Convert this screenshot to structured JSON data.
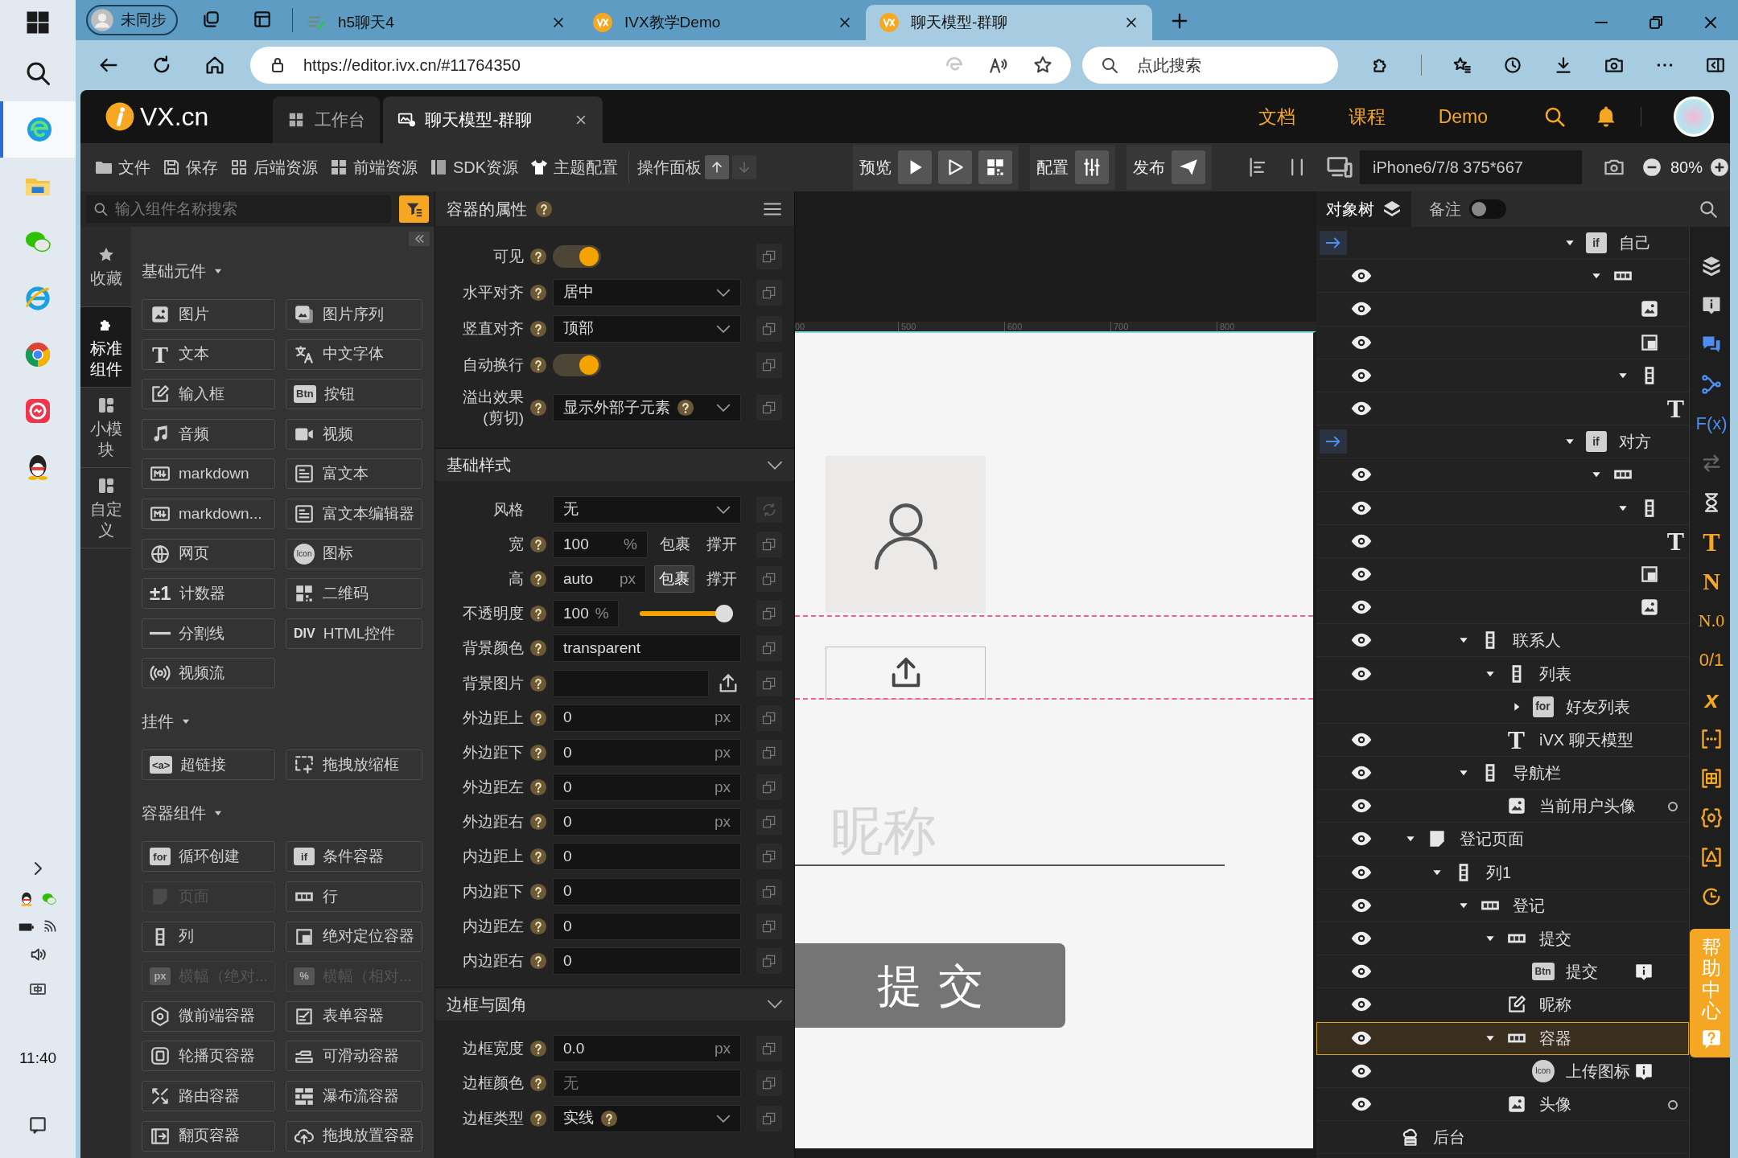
{
  "os_taskbar": {
    "time": "11:40"
  },
  "browser": {
    "profile": "未同步",
    "tabs": [
      {
        "title": "h5聊天4",
        "selected": false
      },
      {
        "title": "IVX教学Demo",
        "selected": false
      },
      {
        "title": "聊天模型-群聊",
        "selected": true
      }
    ],
    "url": "https://editor.ivx.cn/#11764350",
    "search_placeholder": "点此搜索"
  },
  "header": {
    "logo": "VX.cn",
    "tabs": [
      {
        "label": "工作台",
        "selected": false
      },
      {
        "label": "聊天模型-群聊",
        "selected": true
      }
    ],
    "links": [
      "文档",
      "课程",
      "Demo"
    ]
  },
  "toolbar": {
    "items": [
      "文件",
      "保存",
      "后端资源",
      "前端资源",
      "SDK资源",
      "主题配置"
    ],
    "panel_label": "操作面板",
    "preview": "预览",
    "config": "配置",
    "publish": "发布",
    "device": "iPhone6/7/8 375*667",
    "zoom": "80%"
  },
  "components": {
    "search_placeholder": "输入组件名称搜索",
    "side_tabs": [
      {
        "label": "收藏",
        "selected": false
      },
      {
        "label": "标准组件",
        "selected": true
      },
      {
        "label": "小模块",
        "selected": false
      },
      {
        "label": "自定义",
        "selected": false
      }
    ],
    "sections": [
      {
        "title": "基础元件",
        "items": [
          {
            "label": "图片",
            "disabled": false
          },
          {
            "label": "图片序列",
            "disabled": false
          },
          {
            "label": "文本",
            "badge": "T",
            "disabled": false
          },
          {
            "label": "中文字体",
            "disabled": false
          },
          {
            "label": "输入框",
            "disabled": false
          },
          {
            "label": "按钮",
            "badge": "Btn",
            "disabled": false
          },
          {
            "label": "音频",
            "disabled": false
          },
          {
            "label": "视频",
            "disabled": false
          },
          {
            "label": "markdown",
            "disabled": false
          },
          {
            "label": "富文本",
            "disabled": false
          },
          {
            "label": "markdown...",
            "disabled": false
          },
          {
            "label": "富文本编辑器",
            "disabled": false
          },
          {
            "label": "网页",
            "disabled": false
          },
          {
            "label": "图标",
            "badge": "Icon",
            "disabled": false
          },
          {
            "label": "计数器",
            "badge": "±1",
            "disabled": false
          },
          {
            "label": "二维码",
            "disabled": false
          },
          {
            "label": "分割线",
            "disabled": false
          },
          {
            "label": "HTML控件",
            "badge": "DIV",
            "disabled": false
          },
          {
            "label": "视频流",
            "disabled": false
          }
        ]
      },
      {
        "title": "挂件",
        "items": [
          {
            "label": "超链接",
            "badge": "<a>",
            "disabled": false
          },
          {
            "label": "拖拽放缩框",
            "disabled": false
          }
        ]
      },
      {
        "title": "容器组件",
        "items": [
          {
            "label": "循环创建",
            "badge": "for",
            "disabled": false
          },
          {
            "label": "条件容器",
            "badge": "if",
            "disabled": false
          },
          {
            "label": "页面",
            "disabled": true
          },
          {
            "label": "行",
            "disabled": false
          },
          {
            "label": "列",
            "disabled": false
          },
          {
            "label": "绝对定位容器",
            "disabled": false
          },
          {
            "label": "横幅（绝对...",
            "badge": "px",
            "disabled": true
          },
          {
            "label": "横幅（相对...",
            "badge": "%",
            "disabled": true
          },
          {
            "label": "微前端容器",
            "disabled": false
          },
          {
            "label": "表单容器",
            "disabled": false
          },
          {
            "label": "轮播页容器",
            "disabled": false
          },
          {
            "label": "可滑动容器",
            "disabled": false
          },
          {
            "label": "路由容器",
            "disabled": false
          },
          {
            "label": "瀑布流容器",
            "disabled": false
          },
          {
            "label": "翻页容器",
            "disabled": false
          },
          {
            "label": "拖拽放置容器",
            "disabled": false
          }
        ]
      }
    ]
  },
  "props": {
    "title": "容器的属性",
    "rows": [
      {
        "kind": "toggle",
        "label": "可见",
        "help": true,
        "on": true
      },
      {
        "kind": "select",
        "label": "水平对齐",
        "help": true,
        "value": "居中"
      },
      {
        "kind": "select",
        "label": "竖直对齐",
        "help": true,
        "value": "顶部"
      },
      {
        "kind": "toggle",
        "label": "自动换行",
        "help": true,
        "on": true
      },
      {
        "kind": "select",
        "label": "溢出效果",
        "sublabel": "(剪切)",
        "help": true,
        "value": "显示外部子元素",
        "value_help": true
      }
    ],
    "sections": [
      {
        "title": "基础样式",
        "expanded": true,
        "rows": [
          {
            "kind": "preset",
            "label": "风格",
            "help": false,
            "value": "无"
          },
          {
            "kind": "size",
            "label": "宽",
            "help": true,
            "value": "100",
            "unit": "%",
            "options": [
              {
                "label": "包裹",
                "selected": false
              },
              {
                "label": "撑开",
                "selected": false
              }
            ]
          },
          {
            "kind": "size",
            "label": "高",
            "help": true,
            "value": "auto",
            "unit": "px",
            "options": [
              {
                "label": "包裹",
                "selected": true
              },
              {
                "label": "撑开",
                "selected": false
              }
            ]
          },
          {
            "kind": "slider",
            "label": "不透明度",
            "help": true,
            "value": "100",
            "unit": "%",
            "level": 1
          },
          {
            "kind": "input",
            "label": "背景颜色",
            "help": true,
            "value": "transparent"
          },
          {
            "kind": "upload",
            "label": "背景图片",
            "help": true
          },
          {
            "kind": "input",
            "label": "外边距上",
            "help": true,
            "value": "0",
            "unit": "px"
          },
          {
            "kind": "input",
            "label": "外边距下",
            "help": true,
            "value": "0",
            "unit": "px"
          },
          {
            "kind": "input",
            "label": "外边距左",
            "help": true,
            "value": "0",
            "unit": "px"
          },
          {
            "kind": "input",
            "label": "外边距右",
            "help": true,
            "value": "0",
            "unit": "px"
          },
          {
            "kind": "input",
            "label": "内边距上",
            "help": true,
            "value": "0"
          },
          {
            "kind": "input",
            "label": "内边距下",
            "help": true,
            "value": "0"
          },
          {
            "kind": "input",
            "label": "内边距左",
            "help": true,
            "value": "0"
          },
          {
            "kind": "input",
            "label": "内边距右",
            "help": true,
            "value": "0"
          }
        ]
      },
      {
        "title": "边框与圆角",
        "expanded": true,
        "rows": [
          {
            "kind": "input",
            "label": "边框宽度",
            "help": true,
            "value": "0.0",
            "unit": "px"
          },
          {
            "kind": "input",
            "label": "边框颜色",
            "help": true,
            "placeholder": "无"
          },
          {
            "kind": "select",
            "label": "边框类型",
            "help": true,
            "value": "实线",
            "value_help": true
          }
        ]
      }
    ]
  },
  "canvas": {
    "ruler": [
      "00",
      "500",
      "600",
      "700",
      "800"
    ],
    "nickname_placeholder": "昵称",
    "submit": "提交"
  },
  "tree": {
    "tab": "对象树",
    "notes": {
      "label": "备注",
      "on": false
    },
    "nodes": [
      {
        "kind": "if",
        "badge": "if",
        "label": "自己",
        "jump": true,
        "visible": false,
        "selected": false,
        "expanded": true,
        "children": [
          {
            "kind": "row",
            "jump": false,
            "visible": true,
            "selected": false,
            "expanded": true,
            "children": [
              {
                "kind": "image",
                "jump": false,
                "visible": true,
                "selected": false
              },
              {
                "kind": "absolute",
                "jump": false,
                "visible": true,
                "selected": false
              },
              {
                "kind": "column",
                "jump": false,
                "visible": true,
                "selected": false,
                "expanded": true,
                "children": [
                  {
                    "kind": "text",
                    "badge": "T",
                    "jump": false,
                    "visible": true,
                    "selected": false
                  }
                ]
              }
            ]
          }
        ]
      },
      {
        "kind": "if",
        "badge": "if",
        "label": "对方",
        "jump": true,
        "visible": false,
        "selected": false,
        "expanded": true,
        "children": [
          {
            "kind": "row",
            "jump": false,
            "visible": true,
            "selected": false,
            "expanded": true,
            "children": [
              {
                "kind": "column",
                "jump": false,
                "visible": true,
                "selected": false,
                "expanded": true,
                "children": [
                  {
                    "kind": "text",
                    "badge": "T",
                    "jump": false,
                    "visible": true,
                    "selected": false
                  }
                ]
              },
              {
                "kind": "absolute",
                "jump": false,
                "visible": true,
                "selected": false
              },
              {
                "kind": "image",
                "jump": false,
                "visible": true,
                "selected": false
              }
            ]
          }
        ]
      },
      {
        "kind": "column",
        "label": "联系人",
        "jump": false,
        "visible": true,
        "selected": false,
        "expanded": true,
        "children": [
          {
            "kind": "column",
            "label": "列表",
            "jump": false,
            "visible": true,
            "selected": false,
            "expanded": true,
            "children": [
              {
                "kind": "for",
                "badge": "for",
                "label": "好友列表",
                "jump": false,
                "visible": false,
                "selected": false,
                "expanded": false
              }
            ]
          },
          {
            "kind": "text",
            "badge": "T",
            "label": "iVX 聊天模型",
            "jump": false,
            "visible": true,
            "selected": false
          }
        ]
      },
      {
        "kind": "column",
        "label": "导航栏",
        "jump": false,
        "visible": true,
        "selected": false,
        "expanded": true,
        "children": [
          {
            "kind": "image",
            "label": "当前用户头像",
            "jump": false,
            "visible": true,
            "selected": false,
            "dot": true
          }
        ]
      },
      {
        "kind": "page",
        "label": "登记页面",
        "jump": false,
        "visible": true,
        "selected": false,
        "expanded": true,
        "children": [
          {
            "kind": "column",
            "label": "列1",
            "jump": false,
            "visible": true,
            "selected": false,
            "expanded": true,
            "children": [
              {
                "kind": "row",
                "label": "登记",
                "jump": false,
                "visible": true,
                "selected": false,
                "expanded": true,
                "children": [
                  {
                    "kind": "row",
                    "label": "提交",
                    "jump": false,
                    "visible": true,
                    "selected": false,
                    "expanded": true,
                    "children": [
                      {
                        "kind": "button",
                        "badge": "Btn",
                        "label": "提交",
                        "jump": false,
                        "visible": true,
                        "selected": false,
                        "info": true
                      }
                    ]
                  },
                  {
                    "kind": "input",
                    "label": "昵称",
                    "jump": false,
                    "visible": true,
                    "selected": false
                  },
                  {
                    "kind": "row",
                    "label": "容器",
                    "jump": false,
                    "visible": true,
                    "selected": true,
                    "expanded": true,
                    "children": [
                      {
                        "kind": "icon",
                        "badge": "Icon",
                        "label": "上传图标",
                        "jump": false,
                        "visible": true,
                        "selected": false,
                        "info": true
                      }
                    ]
                  },
                  {
                    "kind": "image",
                    "label": "头像",
                    "jump": false,
                    "visible": true,
                    "selected": false,
                    "dot": true
                  }
                ]
              }
            ]
          }
        ]
      },
      {
        "kind": "backend",
        "label": "后台",
        "jump": false,
        "visible": false,
        "selected": false
      }
    ]
  },
  "rail": {
    "glyphs": [
      "F(x)",
      "T",
      "N",
      "N.0",
      "0/1",
      "x"
    ],
    "help": "帮助中心"
  }
}
